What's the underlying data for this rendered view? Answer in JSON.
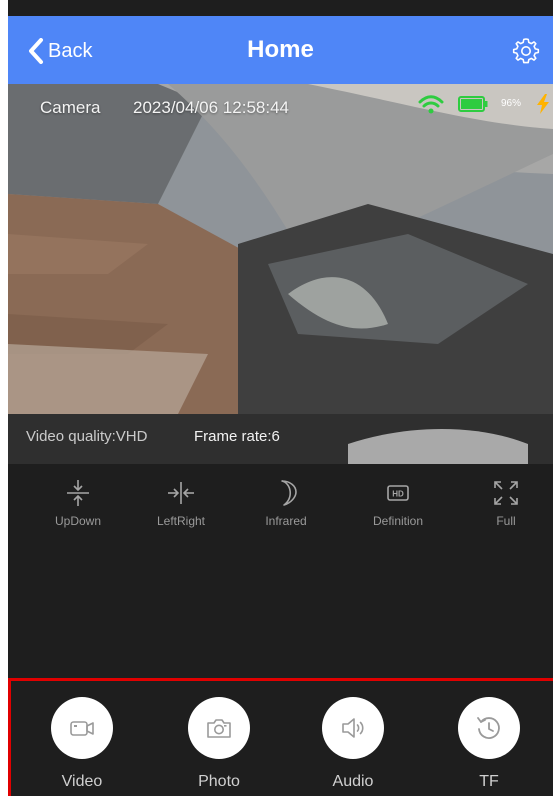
{
  "header": {
    "back_label": "Back",
    "title": "Home"
  },
  "camera": {
    "name": "Camera",
    "timestamp": "2023/04/06 12:58:44",
    "battery_percent": "96%",
    "video_quality": "Video quality:VHD",
    "frame_rate": "Frame rate:6"
  },
  "controls": [
    {
      "label": "UpDown",
      "icon": "flip-vertical-icon"
    },
    {
      "label": "LeftRight",
      "icon": "flip-horizontal-icon"
    },
    {
      "label": "Infrared",
      "icon": "moon-icon"
    },
    {
      "label": "Definition",
      "icon": "hd-icon"
    },
    {
      "label": "Full",
      "icon": "fullscreen-icon"
    }
  ],
  "actions": [
    {
      "label": "Video",
      "icon": "video-camera-icon"
    },
    {
      "label": "Photo",
      "icon": "photo-camera-icon"
    },
    {
      "label": "Audio",
      "icon": "speaker-icon"
    },
    {
      "label": "TF",
      "icon": "history-icon"
    }
  ],
  "colors": {
    "header": "#4f86f7",
    "background": "#1e1e1e",
    "highlight_border": "#e00000",
    "wifi": "#2ecc40",
    "battery": "#2ecc40",
    "charging": "#ffb300"
  }
}
